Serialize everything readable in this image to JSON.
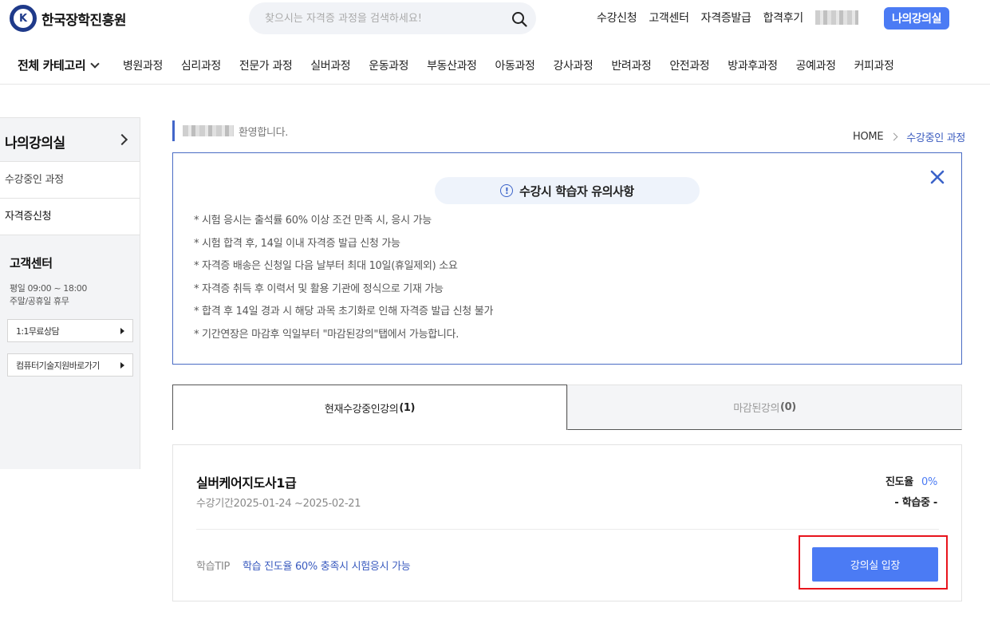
{
  "header": {
    "logo_letter": "K",
    "logo_text": "한국장학진흥원",
    "search_placeholder": "찾으시는 자격증 과정을 검색하세요!",
    "nav": [
      "수강신청",
      "고객센터",
      "자격증발급",
      "합격후기"
    ],
    "my_classroom_button": "나의강의실"
  },
  "categories": {
    "all_label": "전체 카테고리",
    "items": [
      "병원과정",
      "심리과정",
      "전문가 과정",
      "실버과정",
      "운동과정",
      "부동산과정",
      "아동과정",
      "강사과정",
      "반려과정",
      "안전과정",
      "방과후과정",
      "공예과정",
      "커피과정"
    ]
  },
  "sidebar": {
    "title": "나의강의실",
    "links": [
      "수강중인 과정",
      "자격증신청"
    ],
    "customer_center": {
      "title": "고객센터",
      "hours_weekday": "평일 09:00 ~ 18:00",
      "hours_weekend": "주말/공휴일 휴무",
      "buttons": [
        "1:1무료상담",
        "컴퓨터기술지원바로가기"
      ]
    }
  },
  "main": {
    "welcome_text": "환영합니다.",
    "breadcrumb": {
      "home": "HOME",
      "current": "수강중인 과정"
    },
    "notice": {
      "title": "수강시 학습자 유의사항",
      "items": [
        "* 시험 응시는 출석률 60% 이상 조건 만족 시, 응시 가능",
        "* 시험 합격 후, 14일 이내 자격증 발급 신청 가능",
        "* 자격증 배송은 신청일 다음 날부터 최대 10일(휴일제외) 소요",
        "* 자격증 취득 후 이력서 및 활용 기관에 정식으로 기재 가능",
        "* 합격 후 14일 경과 시 해당 과목 초기화로 인해 자격증 발급 신청 불가",
        "* 기간연장은 마감후 익일부터 \"마감된강의\"탭에서 가능합니다."
      ]
    },
    "tabs": [
      {
        "label": "현재수강중인강의",
        "count": "(1)"
      },
      {
        "label": "마감된강의",
        "count": "(0)"
      }
    ],
    "course": {
      "name": "실버케어지도사1급",
      "period": "수강기간2025-01-24 ~2025-02-21",
      "progress_label": "진도율",
      "progress_value": "0%",
      "status": "- 학습중 -",
      "tip_label": "학습TIP",
      "tip_text": "학습 진도율 60% 충족시 시험응시 가능",
      "enter_button": "강의실 입장"
    }
  },
  "colors": {
    "accent": "#4b7bf4",
    "link_blue": "#3a5bbf",
    "notice_border": "#4a6cc4",
    "highlight_red": "#e8141c"
  }
}
